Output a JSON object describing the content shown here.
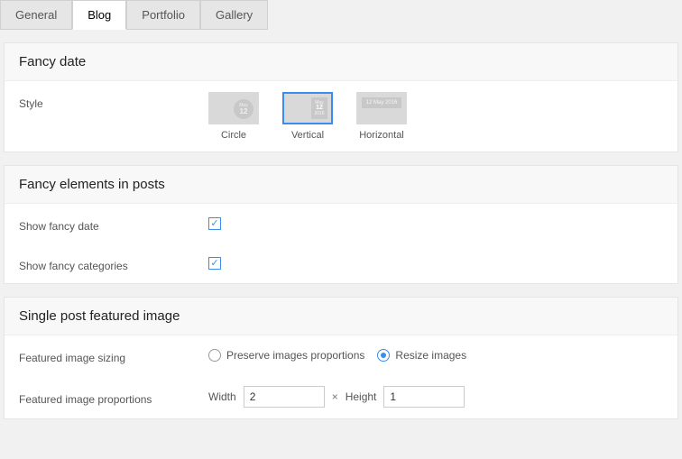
{
  "tabs": [
    "General",
    "Blog",
    "Portfolio",
    "Gallery"
  ],
  "active_tab": 1,
  "fancy_date": {
    "title": "Fancy date",
    "style_label": "Style",
    "options": [
      "Circle",
      "Vertical",
      "Horizontal"
    ],
    "selected": 1
  },
  "fancy_elements": {
    "title": "Fancy elements in posts",
    "show_date_label": "Show fancy date",
    "show_date": true,
    "show_categories_label": "Show fancy categories",
    "show_categories": true
  },
  "featured": {
    "title": "Single post featured image",
    "sizing_label": "Featured image sizing",
    "sizing_options": [
      "Preserve images proportions",
      "Resize images"
    ],
    "sizing_selected": 1,
    "proportions_label": "Featured image proportions",
    "width_label": "Width",
    "width_value": "2",
    "times": "×",
    "height_label": "Height",
    "height_value": "1"
  }
}
